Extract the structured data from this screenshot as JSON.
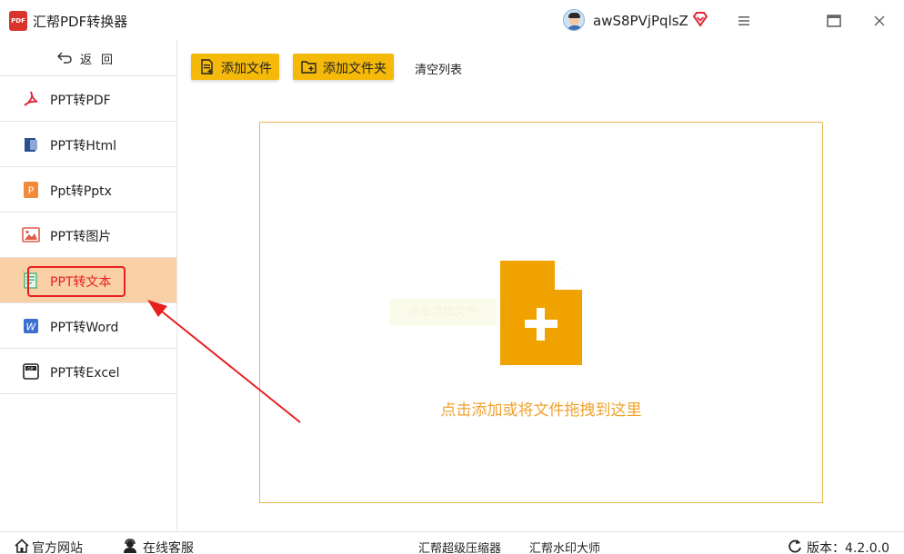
{
  "app": {
    "logo_text": "PDF",
    "title": "汇帮PDF转换器",
    "username": "awS8PVjPqlsZ"
  },
  "sidebar": {
    "back_label": "返回",
    "items": [
      {
        "label": "PPT转PDF",
        "icon": "pdf-icon"
      },
      {
        "label": "PPT转Html",
        "icon": "html-icon"
      },
      {
        "label": "Ppt转Pptx",
        "icon": "pptx-icon"
      },
      {
        "label": "PPT转图片",
        "icon": "image-icon"
      },
      {
        "label": "PPT转文本",
        "icon": "text-icon",
        "active": true
      },
      {
        "label": "PPT转Word",
        "icon": "word-icon"
      },
      {
        "label": "PPT转Excel",
        "icon": "excel-icon"
      }
    ]
  },
  "toolbar": {
    "add_file": "添加文件",
    "add_folder": "添加文件夹",
    "clear_list": "清空列表"
  },
  "dropzone": {
    "hint": "点击添加或将文件拖拽到这里",
    "ghost_hint": "点击添加文件"
  },
  "footer": {
    "website": "官方网站",
    "service": "在线客服",
    "compressor": "汇帮超级压缩器",
    "watermark": "汇帮水印大师",
    "version": "版本：4.2.0.0"
  },
  "colors": {
    "accent": "#f5b90a",
    "active_bg": "#f9cfa6",
    "highlight_red": "#e81f1f",
    "drop_border": "#e9b84a",
    "drop_hint": "#f0a22e"
  }
}
